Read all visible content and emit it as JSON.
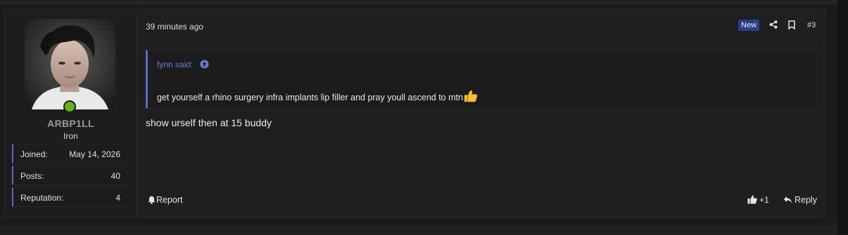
{
  "post": {
    "author": {
      "username": "ARBP1LL",
      "title": "Iron",
      "avatar_icon": "user-avatar-photo",
      "online_color": "#6aae18",
      "stats": [
        {
          "label": "Joined:",
          "value": "May 14, 2026"
        },
        {
          "label": "Posts:",
          "value": "40"
        },
        {
          "label": "Reputation:",
          "value": "4"
        }
      ]
    },
    "timestamp": "39 minutes ago",
    "badge": "New",
    "post_number": "#3",
    "quote": {
      "author_line": "fynn said:",
      "text": "get yourself a rhino surgery infra implants lip filler and pray youll ascend to mtn"
    },
    "message": "show urself then at 15 buddy",
    "actions": {
      "report": "Report",
      "like_count": "+1",
      "reply": "Reply"
    }
  },
  "colors": {
    "accent": "#5c6ac4",
    "quote_author": "#6d7cd6",
    "badge_bg": "#2c3e85"
  }
}
